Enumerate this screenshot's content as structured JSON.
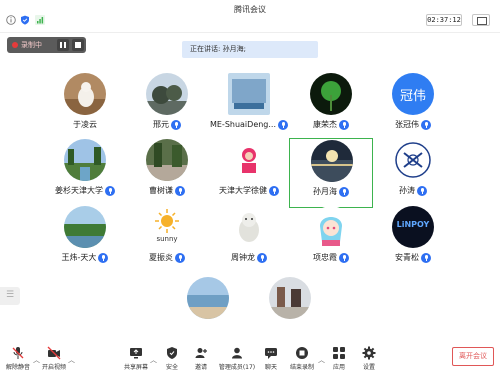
{
  "window": {
    "title": "腾讯会议",
    "timer": "02:37:12"
  },
  "recording": {
    "label": "录制中"
  },
  "banner": {
    "speaking_text": "正在讲话: 孙月海;"
  },
  "participants": [
    {
      "name": "于凌云"
    },
    {
      "name": "邢元"
    },
    {
      "name": "ME-ShuaiDeng..."
    },
    {
      "name": "康荣杰"
    },
    {
      "name": "张冠伟",
      "avatar_text": "冠伟"
    },
    {
      "name": "姜杉天津大学"
    },
    {
      "name": "曹树谦"
    },
    {
      "name": "天津大学徐健"
    },
    {
      "name": "孙月海"
    },
    {
      "name": "孙涛"
    },
    {
      "name": "王炜-天大"
    },
    {
      "name": "夏振炎",
      "avatar_text": "sunny"
    },
    {
      "name": "周钟龙"
    },
    {
      "name": "项忠霞"
    },
    {
      "name": "安青松",
      "avatar_text": "LiNPOY"
    }
  ],
  "toolbar": {
    "mute": "解除静音",
    "video": "开启视频",
    "share": "共享屏幕",
    "security": "安全",
    "invite": "邀请",
    "members": "管理成员(17)",
    "chat": "聊天",
    "end_record": "结束录制",
    "apps": "应用",
    "settings": "设置",
    "leave": "离开会议"
  },
  "colors": {
    "accent": "#2e6ff2",
    "active_border": "#3db34e",
    "leave": "#e05757",
    "banner": "#dde9fa"
  }
}
